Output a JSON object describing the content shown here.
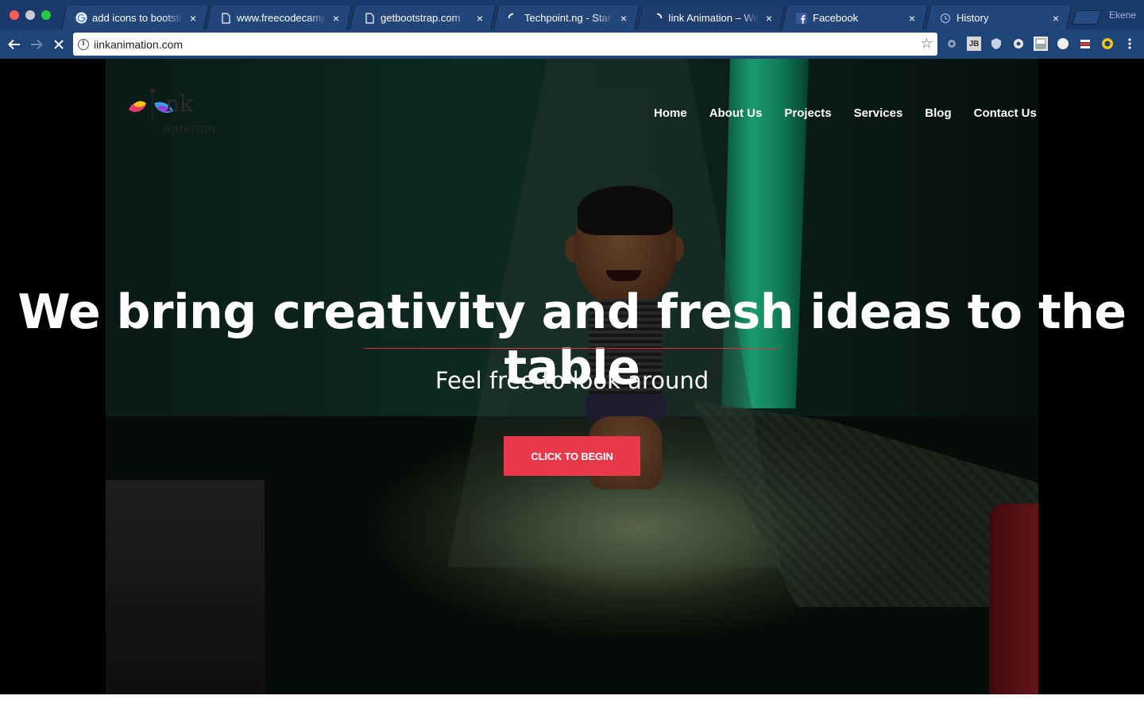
{
  "browser": {
    "tabs": [
      {
        "title": "add icons to bootstrap",
        "favicon": "google-g-icon"
      },
      {
        "title": "www.freecodecamp.org",
        "favicon": "page-icon"
      },
      {
        "title": "getbootstrap.com",
        "favicon": "page-icon"
      },
      {
        "title": "Techpoint.ng - Startups",
        "favicon": "loading-spinner-icon"
      },
      {
        "title": "Iink Animation – We create",
        "favicon": "loading-spinner-icon"
      },
      {
        "title": "Facebook",
        "favicon": "facebook-icon"
      },
      {
        "title": "History",
        "favicon": "history-icon"
      }
    ],
    "close_glyph": "×",
    "profile_name": "Ekene",
    "url": "iinkanimation.com"
  },
  "site": {
    "logo_text": "nk",
    "logo_sub": "NIMATION",
    "nav": [
      "Home",
      "About Us",
      "Projects",
      "Services",
      "Blog",
      "Contact Us"
    ],
    "hero_title": "We bring creativity and fresh ideas to the table",
    "subtitle": "Feel free to look around",
    "cta_label": "CLICK TO BEGIN",
    "accent_color": "#e8384a"
  }
}
